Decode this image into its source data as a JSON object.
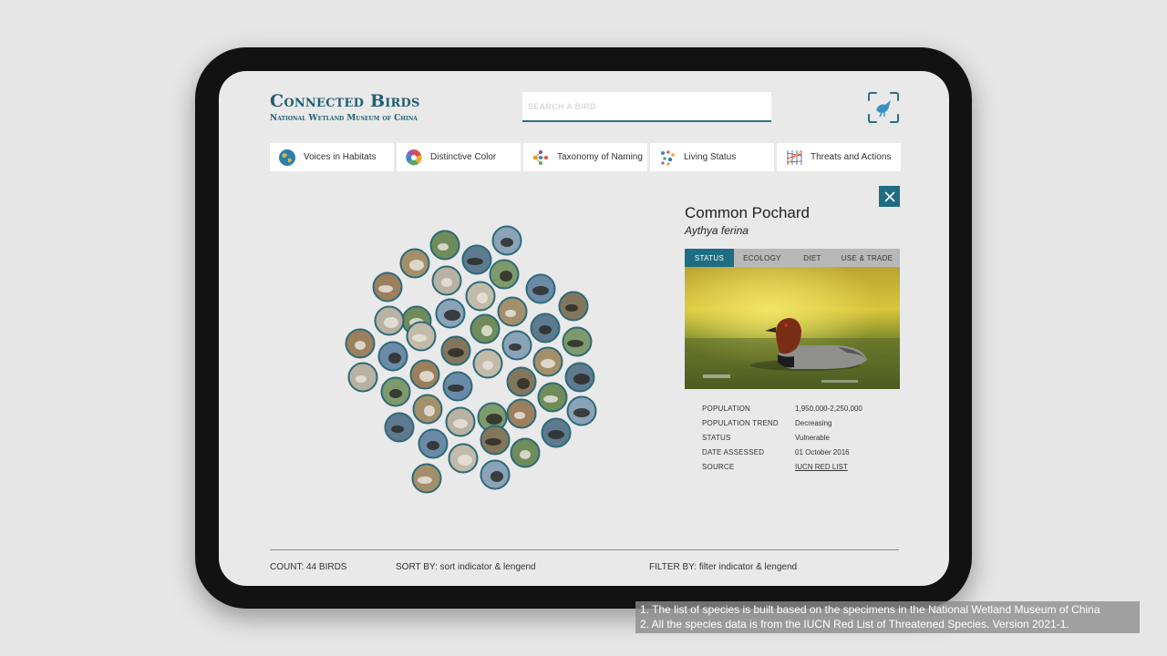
{
  "header": {
    "title": "Connected Birds",
    "subtitle": "National Wetland Museum of China",
    "search_placeholder": "SEARCH A BIRD"
  },
  "nav": [
    {
      "label": "Voices in Habitats",
      "icon": "globe-icon"
    },
    {
      "label": "Distinctive Color",
      "icon": "color-wheel-icon"
    },
    {
      "label": "Taxonomy of Naming",
      "icon": "taxonomy-tree-icon"
    },
    {
      "label": "Living Status",
      "icon": "dots-cluster-icon"
    },
    {
      "label": "Threats and Actions",
      "icon": "network-grid-icon"
    }
  ],
  "bird_collection": {
    "count": 44,
    "ring_color": "#2d6a78"
  },
  "detail": {
    "common_name": "Common Pochard",
    "scientific_name": "Aythya ferina",
    "tabs": [
      "STATUS",
      "ECOLOGY",
      "DIET",
      "USE & TRADE"
    ],
    "active_tab": "STATUS",
    "stats": [
      {
        "key": "POPULATION",
        "value": "1,950,000-2,250,000"
      },
      {
        "key": "POPULATION TREND",
        "value": "Decreasing"
      },
      {
        "key": "STATUS",
        "value": "Vulnerable"
      },
      {
        "key": "DATE ASSESSED",
        "value": "01 October 2016"
      },
      {
        "key": "SOURCE",
        "value": "IUCN RED LIST"
      }
    ]
  },
  "footer": {
    "count": "COUNT: 44 BIRDS",
    "sort": "SORT BY: sort indicator & lengend",
    "filter": "FILTER BY: filter indicator & lengend"
  },
  "caption": {
    "line1": "1. The list of species is built based on the specimens in the National Wetland Museum of China",
    "line2": "2. All the species data is from the IUCN Red List of Threatened Species. Version 2021-1."
  },
  "colors": {
    "brand": "#1f5f73",
    "accent": "#1e6d83",
    "screen_bg": "#e9e9e9",
    "tablet_frame": "#121212"
  }
}
